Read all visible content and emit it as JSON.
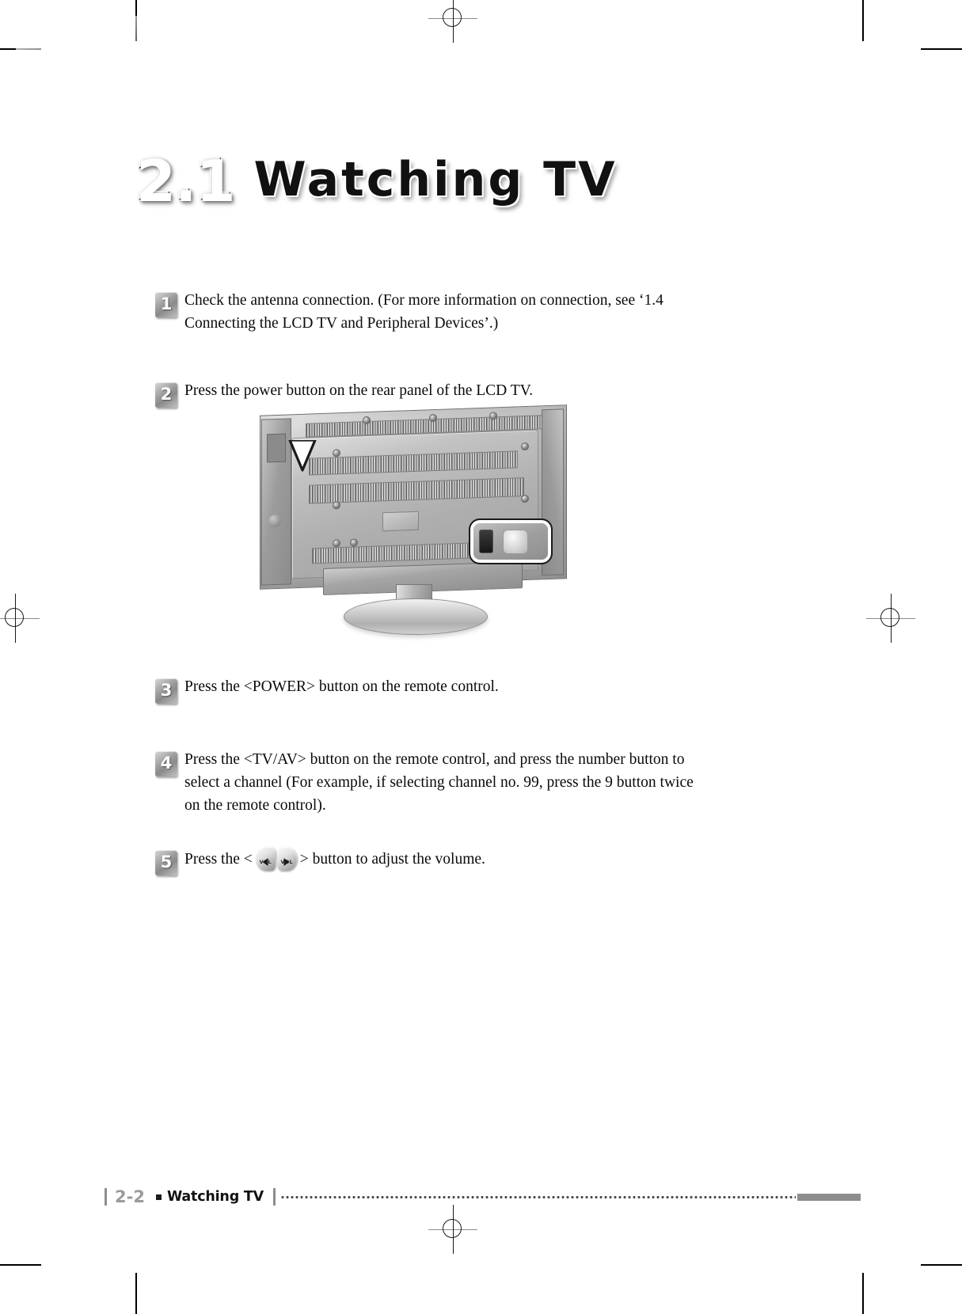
{
  "page": {
    "chapter_number": "2.1",
    "chapter_title": "Watching TV"
  },
  "steps": [
    {
      "number": "1",
      "text": "Check the antenna connection. (For more information on connection, see ‘1.4 Connecting the LCD TV and Peripheral Devices’.)"
    },
    {
      "number": "2",
      "text": "Press the power button on the rear panel of the LCD TV."
    },
    {
      "number": "3",
      "text": "Press the <POWER> button on the remote control."
    },
    {
      "number": "4",
      "text": "Press the <TV/AV> button on the remote control, and press the number button to select a channel (For example, if selecting channel no. 99, press the 9 button twice on the remote control)."
    },
    {
      "number": "5",
      "text_before": "Press the <",
      "text_after": "> button to adjust the volume.",
      "vol_left_label": "VOL",
      "vol_right_label": "VOL"
    }
  ],
  "figure": {
    "caption_alt": "Rear panel of LCD TV with power button highlighted",
    "callout_name": "power-button-callout"
  },
  "footer": {
    "page_number": "2-2",
    "section_label": "Watching TV"
  },
  "colors": {
    "text": "#0a0a0a",
    "badge_gray": "#9e9e9e",
    "footer_gray": "#8d8d8d",
    "page_number_gray": "#9b9b9b"
  }
}
